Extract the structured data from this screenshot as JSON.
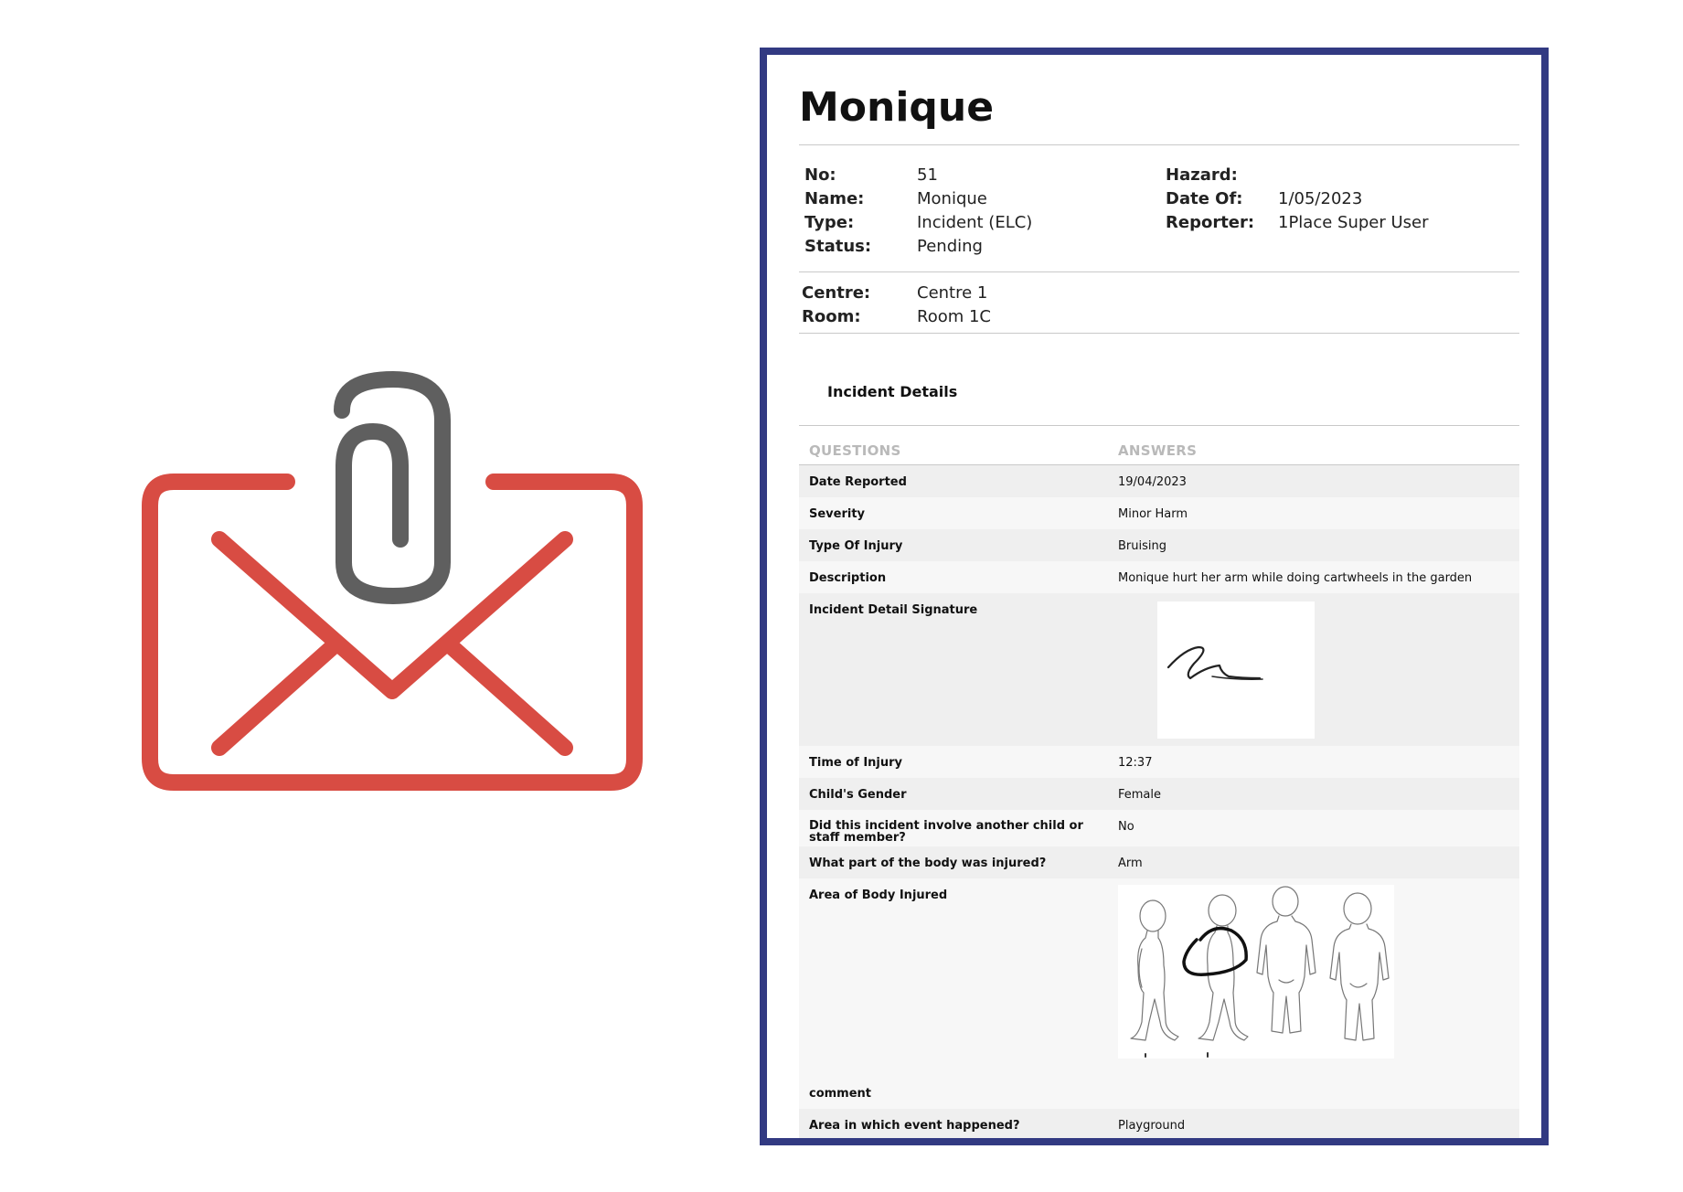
{
  "report": {
    "title": "Monique",
    "fields": {
      "no_label": "No:",
      "no_value": "51",
      "name_label": "Name:",
      "name_value": "Monique",
      "type_label": "Type:",
      "type_value": "Incident (ELC)",
      "status_label": "Status:",
      "status_value": "Pending",
      "hazard_label": "Hazard:",
      "hazard_value": "",
      "date_label": "Date Of:",
      "date_value": "1/05/2023",
      "reporter_label": "Reporter:",
      "reporter_value": "1Place Super User"
    },
    "location": {
      "centre_label": "Centre:",
      "centre_value": "Centre 1",
      "room_label": "Room:",
      "room_value": "Room 1C"
    },
    "section_title": "Incident Details",
    "table": {
      "col_questions": "QUESTIONS",
      "col_answers": "ANSWERS",
      "rows": [
        {
          "q": "Date Reported",
          "a": "19/04/2023"
        },
        {
          "q": "Severity",
          "a": "Minor Harm"
        },
        {
          "q": "Type Of Injury",
          "a": "Bruising"
        },
        {
          "q": "Description",
          "a": "Monique hurt her arm while doing cartwheels in the garden"
        },
        {
          "q": "Incident Detail Signature",
          "a": ""
        },
        {
          "q": "Time of Injury",
          "a": "12:37"
        },
        {
          "q": "Child's Gender",
          "a": "Female"
        },
        {
          "q": "Did this incident involve another child or staff member?",
          "a": "No"
        },
        {
          "q": "What part of the body was injured?",
          "a": "Arm"
        },
        {
          "q": "Area of Body Injured",
          "a": ""
        },
        {
          "q": "comment",
          "a": ""
        },
        {
          "q": "Area in which event happened?",
          "a": "Playground"
        }
      ]
    }
  },
  "colors": {
    "border": "#323a82",
    "envelope": "#d84c43",
    "paperclip": "#5f5f5f"
  },
  "icons": [
    "envelope-attachment-icon",
    "paperclip-icon",
    "signature-image",
    "body-diagram-image"
  ]
}
